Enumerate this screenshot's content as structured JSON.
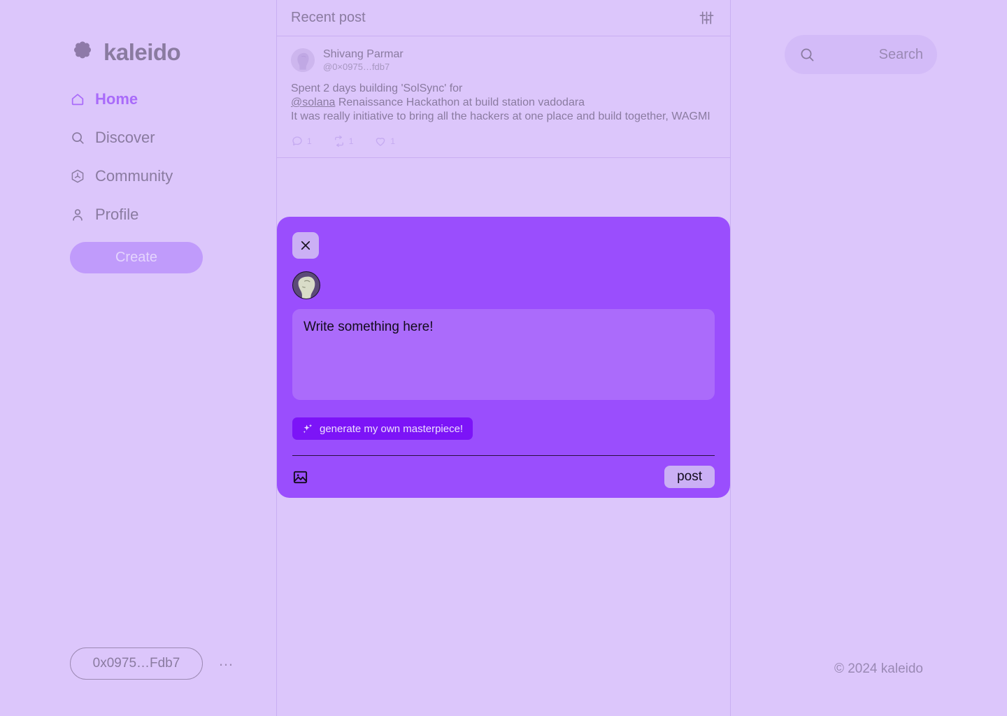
{
  "brand": {
    "name": "kaleido",
    "logo_icon": "flower-scallop-icon"
  },
  "sidebar": {
    "items": [
      {
        "label": "Home",
        "icon": "home-icon",
        "active": true
      },
      {
        "label": "Discover",
        "icon": "search-icon",
        "active": false
      },
      {
        "label": "Community",
        "icon": "hexagon-community-icon",
        "active": false
      },
      {
        "label": "Profile",
        "icon": "user-icon",
        "active": false
      }
    ],
    "create_label": "Create",
    "wallet_address": "0x0975…Fdb7",
    "wallet_more_label": "…"
  },
  "search": {
    "placeholder": "Search",
    "icon": "search-icon"
  },
  "feed": {
    "header_title": "Recent post",
    "filter_icon": "sliders-filter-icon",
    "post": {
      "author_name": "Shivang Parmar",
      "author_handle": "@0×0975…fdb7",
      "avatar_icon": "statue-avatar",
      "body_line1": "Spent 2 days building 'SolSync' for",
      "mention": "@solana",
      "body_line2_rest": " Renaissance Hackathon at build station vadodara",
      "body_line3": "It was really initiative to bring all the hackers at one place and build together, WAGMI",
      "stats": [
        {
          "icon": "comment-icon",
          "count": "1"
        },
        {
          "icon": "repost-icon",
          "count": "1"
        },
        {
          "icon": "heart-icon",
          "count": "1"
        }
      ]
    }
  },
  "compose_modal": {
    "close_icon": "close-icon",
    "avatar_icon": "statue-avatar",
    "textarea_value": "Write something here!",
    "textarea_placeholder": "Write something here!",
    "generate_label": "generate my own masterpiece!",
    "generate_icon": "sparkles-icon",
    "image_icon": "image-upload-icon",
    "post_label": "post"
  },
  "footer": {
    "copyright": "© 2024 kaleido"
  },
  "colors": {
    "page_bg": "#dcc6fb",
    "accent": "#a96bfa",
    "modal_bg": "#9a4efd",
    "textarea_bg": "#ab6bfb",
    "generate_btn_bg": "#7c14f7",
    "muted_text": "#8a7ba0"
  }
}
